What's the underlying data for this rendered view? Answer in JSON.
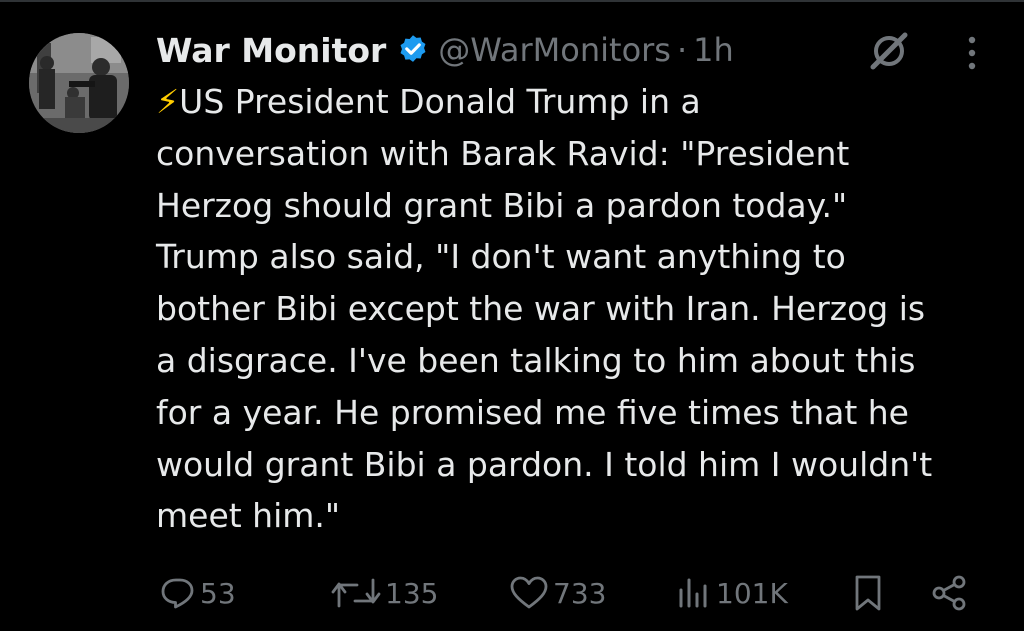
{
  "tweet": {
    "author_name": "War Monitor",
    "handle": "@WarMonitors",
    "separator": "·",
    "time": "1h",
    "bolt": "⚡",
    "lines": [
      "US President Donald Trump in a",
      "conversation with Barak Ravid: \"President",
      "Herzog should grant Bibi a pardon today.\"",
      "Trump also said, \"I don't want anything to",
      "bother Bibi except the war with Iran. Herzog is",
      "a disgrace. I've been talking to him about this",
      "for a year. He promised me five times that he",
      "would grant Bibi a pardon. I told him I wouldn't",
      "meet him.\""
    ]
  },
  "actions": {
    "replies": "53",
    "reposts": "135",
    "likes": "733",
    "views": "101K"
  },
  "icons": {
    "verified": "verified-badge-icon",
    "grok": "grok-icon",
    "more": "more-icon",
    "reply": "reply-icon",
    "repost": "repost-icon",
    "like": "like-icon",
    "views": "views-icon",
    "bookmark": "bookmark-icon",
    "share": "share-icon"
  },
  "colors": {
    "background": "#000000",
    "text": "#e7e9ea",
    "muted": "#71767b",
    "verified": "#1d9bf0",
    "bolt": "#ffcc00"
  }
}
